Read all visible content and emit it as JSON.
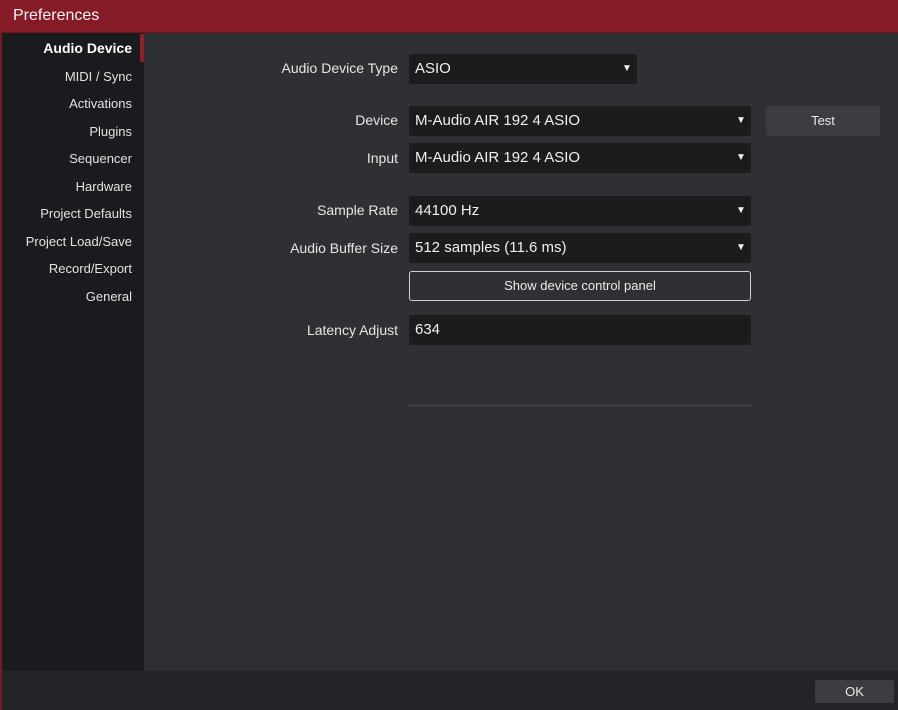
{
  "window": {
    "title": "Preferences"
  },
  "sidebar": {
    "items": [
      {
        "label": "Audio Device",
        "active": true
      },
      {
        "label": "MIDI / Sync",
        "active": false
      },
      {
        "label": "Activations",
        "active": false
      },
      {
        "label": "Plugins",
        "active": false
      },
      {
        "label": "Sequencer",
        "active": false
      },
      {
        "label": "Hardware",
        "active": false
      },
      {
        "label": "Project Defaults",
        "active": false
      },
      {
        "label": "Project Load/Save",
        "active": false
      },
      {
        "label": "Record/Export",
        "active": false
      },
      {
        "label": "General",
        "active": false
      }
    ]
  },
  "audio_device": {
    "type": {
      "label": "Audio Device Type",
      "value": "ASIO"
    },
    "device": {
      "label": "Device",
      "value": "M-Audio AIR 192 4 ASIO"
    },
    "input": {
      "label": "Input",
      "value": "M-Audio AIR 192 4 ASIO"
    },
    "sample_rate": {
      "label": "Sample Rate",
      "value": "44100 Hz"
    },
    "buffer_size": {
      "label": "Audio Buffer Size",
      "value": "512 samples (11.6 ms)"
    },
    "latency": {
      "label": "Latency Adjust",
      "value": "634"
    },
    "test_button": "Test",
    "control_panel_button": "Show device control panel",
    "dropdown_glyph": "▼"
  },
  "footer": {
    "ok_button": "OK"
  },
  "colors": {
    "titlebar": "#861b28",
    "accent": "#8e1e2b",
    "panel": "#2f3033",
    "field": "#1b1c1e"
  }
}
